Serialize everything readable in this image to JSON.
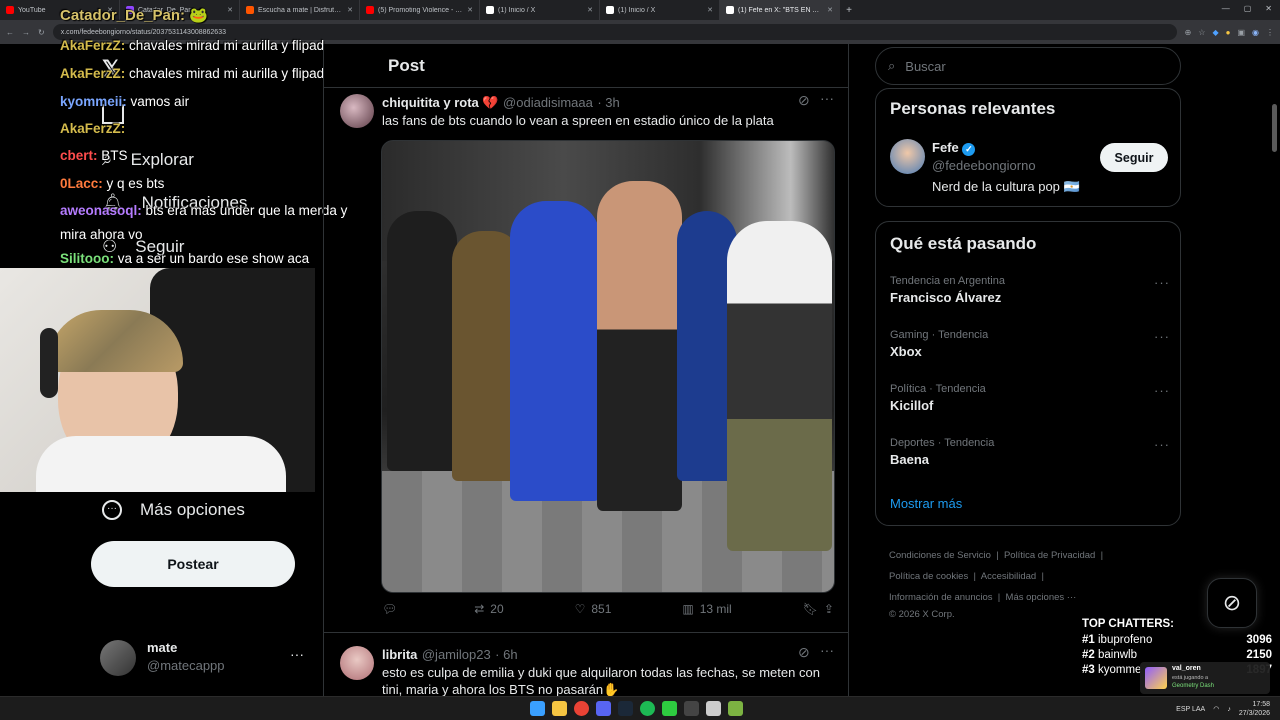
{
  "browser": {
    "tabs": [
      {
        "title": "YouTube",
        "color": "#ff0000"
      },
      {
        "title": "Catador_De_Pan",
        "color": "#9146ff"
      },
      {
        "title": "Escucha a mate | Disfruta de la",
        "color": "#ff5500"
      },
      {
        "title": "(5) Promoting Violence - YouTu",
        "color": "#ff0000"
      },
      {
        "title": "(1) Inicio / X",
        "color": "#ffffff"
      },
      {
        "title": "(1) Inicio / X",
        "color": "#ffffff"
      },
      {
        "title": "(1) Fefe en X: \"BTS EN ARG",
        "color": "#ffffff"
      }
    ],
    "url": "x.com/fedeebongiorno/status/2037531143008862633"
  },
  "stream_chat": {
    "title": "Catador_De_Pan:",
    "messages": [
      {
        "user": "AkaFerzZ:",
        "text": "chavales mirad mi aurilla y flipad",
        "color": "#d4bb4c"
      },
      {
        "user": "AkaFerzZ:",
        "text": "chavales mirad mi aurilla y flipad",
        "color": "#d4bb4c"
      },
      {
        "user": "kyommeii:",
        "text": "vamos air",
        "color": "#7aa6ff"
      },
      {
        "user": "AkaFerzZ:",
        "text": "",
        "color": "#d4bb4c"
      },
      {
        "user": "cbert:",
        "text": "BTS",
        "color": "#ff4d4d"
      },
      {
        "user": "0Lacc:",
        "text": "y q es bts",
        "color": "#ff7a3d"
      },
      {
        "user": "aweonasoql:",
        "text": "bts era más under que la merda y mira ahora vo",
        "color": "#b57cff"
      },
      {
        "user": "Silitooo:",
        "text": "va a ser un bardo ese show aca",
        "color": "#7ae07a"
      }
    ]
  },
  "left_nav": {
    "items": [
      {
        "label": "Explorar",
        "icon": "search-icon"
      },
      {
        "label": "Notificaciones",
        "icon": "bell-icon"
      },
      {
        "label": "Seguir",
        "icon": "follow-icon"
      },
      {
        "label": "Más opciones",
        "icon": "more-circle-icon"
      }
    ],
    "post_button": "Postear",
    "account": {
      "name": "mate",
      "handle": "@matecappp"
    }
  },
  "main": {
    "header": "Post",
    "tweets": [
      {
        "name": "chiquitita y rota 💔",
        "handle": "@odiadisimaaa",
        "time": "· 3h",
        "text": "las fans de bts cuando lo vean a spreen en estadio único de la plata",
        "replies": "",
        "retweets": "20",
        "likes": "851",
        "views": "13 mil"
      },
      {
        "name": "librita",
        "handle": "@jamilop23",
        "time": "· 6h",
        "text": "esto es culpa de emilia y duki que alquilaron todas las fechas, se meten con tini, maria y ahora los BTS  no pasarán✋"
      }
    ]
  },
  "sidebar": {
    "search_placeholder": "Buscar",
    "relevant": {
      "title": "Personas relevantes",
      "person": {
        "name": "Fefe",
        "handle": "@fedeebongiorno",
        "bio": "Nerd de la cultura pop 🇦🇷",
        "follow": "Seguir"
      }
    },
    "trends": {
      "title": "Qué está pasando",
      "items": [
        {
          "meta": "Tendencia en Argentina",
          "name": "Francisco Álvarez"
        },
        {
          "meta": "Gaming · Tendencia",
          "name": "Xbox"
        },
        {
          "meta": "Política · Tendencia",
          "name": "Kicillof"
        },
        {
          "meta": "Deportes · Tendencia",
          "name": "Baena"
        }
      ],
      "more": "Mostrar más"
    },
    "footer": {
      "links": [
        "Condiciones de Servicio",
        "Política de Privacidad",
        "Política de cookies",
        "Accesibilidad",
        "Información de anuncios",
        "Más opciones ···"
      ],
      "copyright": "© 2026 X Corp."
    }
  },
  "top_chatters": {
    "title": "TOP CHATTERS:",
    "rows": [
      {
        "rank": "#1",
        "name": "ibuprofeno",
        "count": "3096"
      },
      {
        "rank": "#2",
        "name": "bainwlb",
        "count": "2150"
      },
      {
        "rank": "#3",
        "name": "kyomme",
        "count": "1897"
      }
    ]
  },
  "now_playing": {
    "name": "val_oren",
    "status": "está jugando a",
    "game": "Geometry Dash"
  },
  "taskbar": {
    "lang": "ESP LAA",
    "time": "17:58",
    "date": "27/3/2026"
  },
  "colors": {
    "accent": "#1d9bf0",
    "border": "#2f3336",
    "muted": "#71767b"
  }
}
